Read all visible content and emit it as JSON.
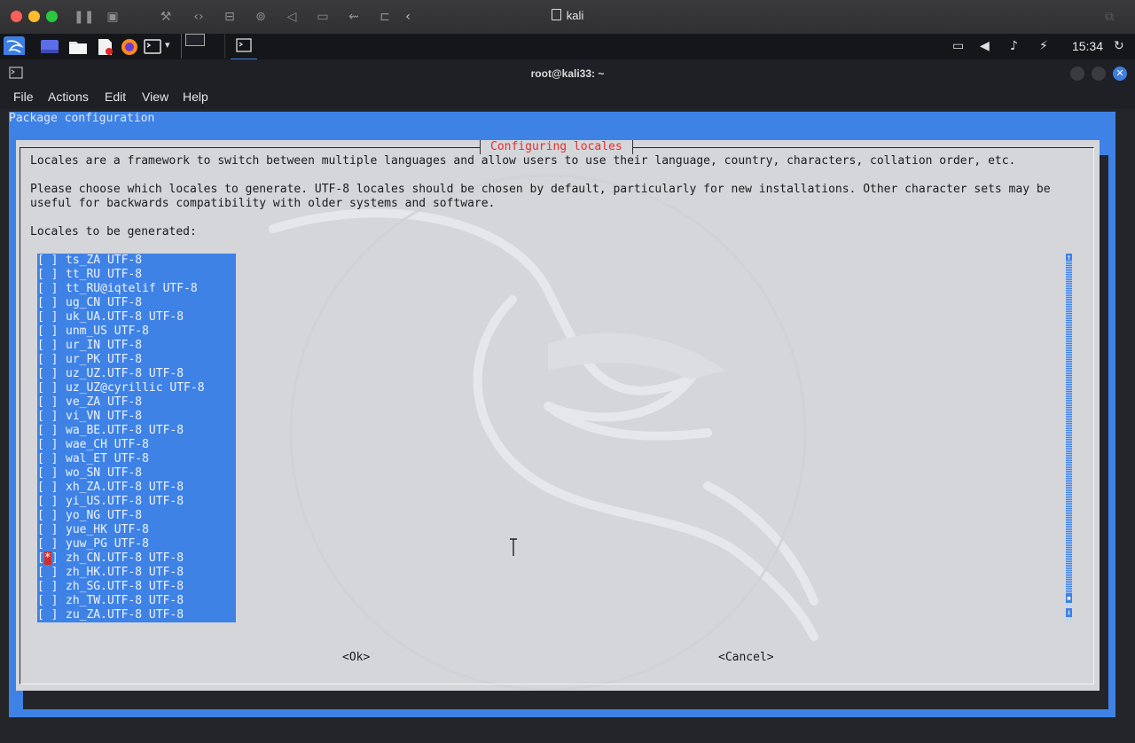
{
  "vm_window": {
    "title": "kali"
  },
  "panel": {
    "clock": "15:34"
  },
  "terminal": {
    "title": "root@kali33: ~",
    "menu": [
      "File",
      "Actions",
      "Edit",
      "View",
      "Help"
    ]
  },
  "dialog": {
    "screen_title": "Package configuration",
    "title": "Configuring locales",
    "line1": "Locales are a framework to switch between multiple languages and allow users to use their language, country, characters, collation order, etc.",
    "line2": "Please choose which locales to generate. UTF-8 locales should be chosen by default, particularly for new installations. Other character sets may be",
    "line3": "useful for backwards compatibility with older systems and software.",
    "prompt": "Locales to be generated:",
    "locales": [
      {
        "label": "ts_ZA UTF-8",
        "checked": false
      },
      {
        "label": "tt_RU UTF-8",
        "checked": false
      },
      {
        "label": "tt_RU@iqtelif UTF-8",
        "checked": false
      },
      {
        "label": "ug_CN UTF-8",
        "checked": false
      },
      {
        "label": "uk_UA.UTF-8 UTF-8",
        "checked": false
      },
      {
        "label": "unm_US UTF-8",
        "checked": false
      },
      {
        "label": "ur_IN UTF-8",
        "checked": false
      },
      {
        "label": "ur_PK UTF-8",
        "checked": false
      },
      {
        "label": "uz_UZ.UTF-8 UTF-8",
        "checked": false
      },
      {
        "label": "uz_UZ@cyrillic UTF-8",
        "checked": false
      },
      {
        "label": "ve_ZA UTF-8",
        "checked": false
      },
      {
        "label": "vi_VN UTF-8",
        "checked": false
      },
      {
        "label": "wa_BE.UTF-8 UTF-8",
        "checked": false
      },
      {
        "label": "wae_CH UTF-8",
        "checked": false
      },
      {
        "label": "wal_ET UTF-8",
        "checked": false
      },
      {
        "label": "wo_SN UTF-8",
        "checked": false
      },
      {
        "label": "xh_ZA.UTF-8 UTF-8",
        "checked": false
      },
      {
        "label": "yi_US.UTF-8 UTF-8",
        "checked": false
      },
      {
        "label": "yo_NG UTF-8",
        "checked": false
      },
      {
        "label": "yue_HK UTF-8",
        "checked": false
      },
      {
        "label": "yuw_PG UTF-8",
        "checked": false
      },
      {
        "label": "zh_CN.UTF-8 UTF-8",
        "checked": true
      },
      {
        "label": "zh_HK.UTF-8 UTF-8",
        "checked": false
      },
      {
        "label": "zh_SG.UTF-8 UTF-8",
        "checked": false
      },
      {
        "label": "zh_TW.UTF-8 UTF-8",
        "checked": false
      },
      {
        "label": "zu_ZA.UTF-8 UTF-8",
        "checked": false
      }
    ],
    "checkbox_empty": "[ ]",
    "checkbox_mark": "*",
    "ok": "<Ok>",
    "cancel": "<Cancel>"
  },
  "colors": {
    "dialog_blue": "#3f82e6",
    "dialog_gray": "#d4d6da",
    "title_red": "#e23030",
    "check_red": "#d42b2b"
  },
  "icons": [
    "kali-menu-icon",
    "desktop-icon",
    "file-manager-icon",
    "text-editor-icon",
    "firefox-icon",
    "terminal-icon",
    "network-icon",
    "volume-icon",
    "bell-icon",
    "power-icon",
    "refresh-icon"
  ]
}
